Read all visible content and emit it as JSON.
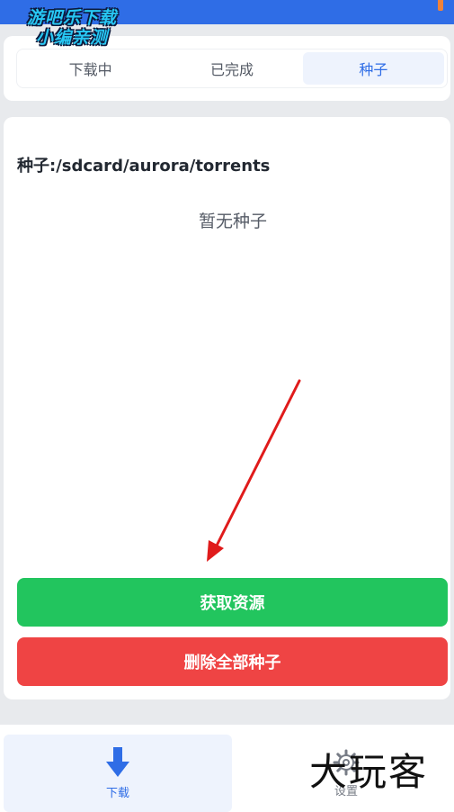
{
  "watermark": {
    "line1": "游吧乐下载",
    "line2": "小编亲测"
  },
  "tabs": [
    {
      "label": "下载中",
      "active": false
    },
    {
      "label": "已完成",
      "active": false
    },
    {
      "label": "种子",
      "active": true
    }
  ],
  "main": {
    "path_label": "种子:/sdcard/aurora/torrents",
    "empty_text": "暂无种子",
    "get_resources_label": "获取资源",
    "delete_all_label": "删除全部种子"
  },
  "bottom_nav": {
    "download_label": "下载",
    "settings_label": "设置"
  },
  "brand_watermark": "大玩客",
  "colors": {
    "accent_blue": "#2f6de6",
    "green_button": "#22c55e",
    "red_button": "#ef4444",
    "annotation_arrow": "#e01b1b"
  }
}
